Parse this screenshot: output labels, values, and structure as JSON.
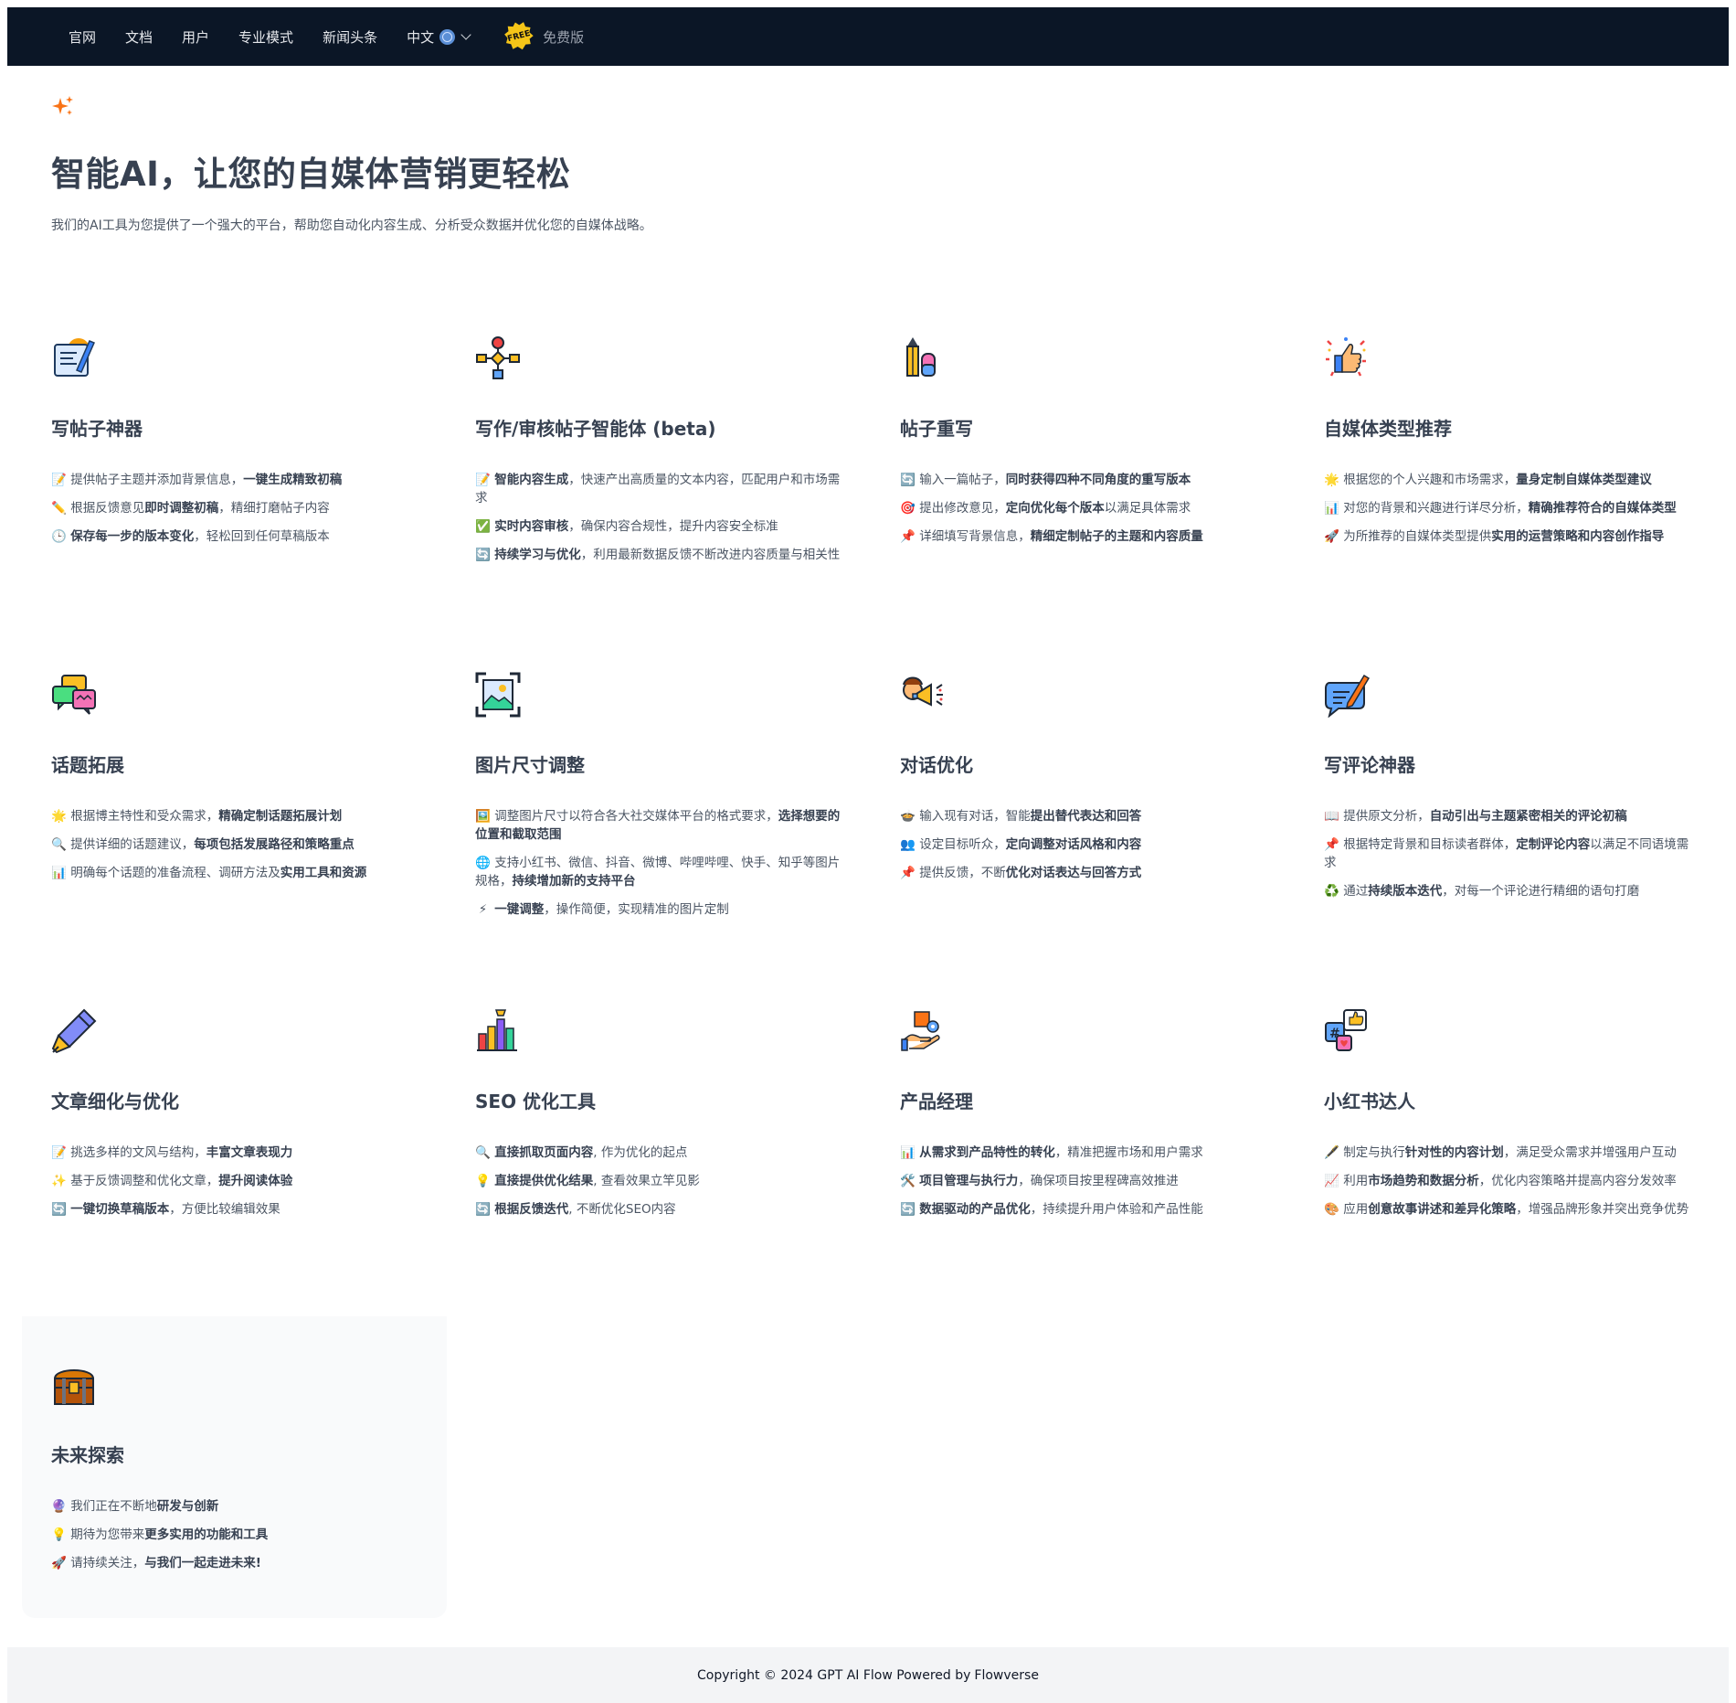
{
  "nav": {
    "items": [
      "官网",
      "文档",
      "用户",
      "专业模式",
      "新闻头条"
    ],
    "language": "中文",
    "badge_text": "FREE",
    "plan": "免费版"
  },
  "hero": {
    "icon": "sparkles-icon",
    "title": "智能AI，让您的自媒体营销更轻松",
    "subtitle": "我们的AI工具为您提供了一个强大的平台，帮助您自动化内容生成、分析受众数据并优化您的自媒体战略。"
  },
  "cards": [
    {
      "icon": "notepad-pen-icon",
      "title": "写帖子神器",
      "bullets": [
        {
          "emoji": "📝",
          "parts": [
            {
              "t": "提供帖子主题并添加背景信息，"
            },
            {
              "t": "一键生成精致初稿",
              "b": true
            }
          ]
        },
        {
          "emoji": "✏️",
          "parts": [
            {
              "t": "根据反馈意见"
            },
            {
              "t": "即时调整初稿",
              "b": true
            },
            {
              "t": "，精细打磨帖子内容"
            }
          ]
        },
        {
          "emoji": "🕒",
          "parts": [
            {
              "t": "保存每一步的版本变化",
              "b": true
            },
            {
              "t": "，轻松回到任何草稿版本"
            }
          ]
        }
      ]
    },
    {
      "icon": "flowchart-icon",
      "title": "写作/审核帖子智能体 (beta)",
      "bullets": [
        {
          "emoji": "📝",
          "parts": [
            {
              "t": "智能内容生成",
              "b": true
            },
            {
              "t": "，快速产出高质量的文本内容，匹配用户和市场需求"
            }
          ]
        },
        {
          "emoji": "✅",
          "parts": [
            {
              "t": "实时内容审核",
              "b": true
            },
            {
              "t": "，确保内容合规性，提升内容安全标准"
            }
          ]
        },
        {
          "emoji": "🔄",
          "parts": [
            {
              "t": "持续学习与优化",
              "b": true
            },
            {
              "t": "，利用最新数据反馈不断改进内容质量与相关性"
            }
          ]
        }
      ]
    },
    {
      "icon": "pencil-eraser-icon",
      "title": "帖子重写",
      "bullets": [
        {
          "emoji": "🔄",
          "parts": [
            {
              "t": "输入一篇帖子，"
            },
            {
              "t": "同时获得四种不同角度的重写版本",
              "b": true
            }
          ]
        },
        {
          "emoji": "🎯",
          "parts": [
            {
              "t": "提出修改意见，"
            },
            {
              "t": "定向优化每个版本",
              "b": true
            },
            {
              "t": "以满足具体需求"
            }
          ]
        },
        {
          "emoji": "📌",
          "parts": [
            {
              "t": "详细填写背景信息，"
            },
            {
              "t": "精细定制帖子的主题和内容质量",
              "b": true
            }
          ]
        }
      ]
    },
    {
      "icon": "thumbs-up-confetti-icon",
      "title": "自媒体类型推荐",
      "bullets": [
        {
          "emoji": "🌟",
          "parts": [
            {
              "t": "根据您的个人兴趣和市场需求，"
            },
            {
              "t": "量身定制自媒体类型建议",
              "b": true
            }
          ]
        },
        {
          "emoji": "📊",
          "parts": [
            {
              "t": "对您的背景和兴趣进行详尽分析，"
            },
            {
              "t": "精确推荐符合的自媒体类型",
              "b": true
            }
          ]
        },
        {
          "emoji": "🚀",
          "parts": [
            {
              "t": "为所推荐的自媒体类型提供"
            },
            {
              "t": "实用的运营策略和内容创作指导",
              "b": true
            }
          ]
        }
      ]
    },
    {
      "icon": "chat-bubbles-icon",
      "title": "话题拓展",
      "bullets": [
        {
          "emoji": "🌟",
          "parts": [
            {
              "t": "根据博主特性和受众需求，"
            },
            {
              "t": "精确定制话题拓展计划",
              "b": true
            }
          ]
        },
        {
          "emoji": "🔍",
          "parts": [
            {
              "t": "提供详细的话题建议，"
            },
            {
              "t": "每项包括发展路径和策略重点",
              "b": true
            }
          ]
        },
        {
          "emoji": "📊",
          "parts": [
            {
              "t": "明确每个话题的准备流程、调研方法及"
            },
            {
              "t": "实用工具和资源",
              "b": true
            }
          ]
        }
      ]
    },
    {
      "icon": "image-resize-icon",
      "title": "图片尺寸调整",
      "bullets": [
        {
          "emoji": "🖼️",
          "parts": [
            {
              "t": "调整图片尺寸以符合各大社交媒体平台的格式要求，"
            },
            {
              "t": "选择想要的位置和截取范围",
              "b": true
            }
          ]
        },
        {
          "emoji": "🌐",
          "parts": [
            {
              "t": "支持小红书、微信、抖音、微博、哔哩哔哩、快手、知乎等图片规格，"
            },
            {
              "t": "持续增加新的支持平台",
              "b": true
            }
          ]
        },
        {
          "emoji": "⚡",
          "parts": [
            {
              "t": "一键调整",
              "b": true
            },
            {
              "t": "，操作简便，实现精准的图片定制"
            }
          ]
        }
      ]
    },
    {
      "icon": "megaphone-person-icon",
      "title": "对话优化",
      "bullets": [
        {
          "emoji": "🍲",
          "parts": [
            {
              "t": "输入现有对话，智能"
            },
            {
              "t": "提出替代表达和回答",
              "b": true
            }
          ]
        },
        {
          "emoji": "👥",
          "parts": [
            {
              "t": "设定目标听众，"
            },
            {
              "t": "定向调整对话风格和内容",
              "b": true
            }
          ]
        },
        {
          "emoji": "📌",
          "parts": [
            {
              "t": "提供反馈，不断"
            },
            {
              "t": "优化对话表达与回答方式",
              "b": true
            }
          ]
        }
      ]
    },
    {
      "icon": "speech-pencil-icon",
      "title": "写评论神器",
      "bullets": [
        {
          "emoji": "📖",
          "parts": [
            {
              "t": "提供原文分析，"
            },
            {
              "t": "自动引出与主题紧密相关的评论初稿",
              "b": true
            }
          ]
        },
        {
          "emoji": "📌",
          "parts": [
            {
              "t": "根据特定背景和目标读者群体，"
            },
            {
              "t": "定制评论内容",
              "b": true
            },
            {
              "t": "以满足不同语境需求"
            }
          ]
        },
        {
          "emoji": "♻️",
          "parts": [
            {
              "t": "通过"
            },
            {
              "t": "持续版本迭代",
              "b": true
            },
            {
              "t": "，对每一个评论进行精细的语句打磨"
            }
          ]
        }
      ]
    },
    {
      "icon": "fountain-pen-icon",
      "title": "文章细化与优化",
      "bullets": [
        {
          "emoji": "📝",
          "parts": [
            {
              "t": "挑选多样的文风与结构，"
            },
            {
              "t": "丰富文章表现力",
              "b": true
            }
          ]
        },
        {
          "emoji": "✨",
          "parts": [
            {
              "t": "基于反馈调整和优化文章，"
            },
            {
              "t": "提升阅读体验",
              "b": true
            }
          ]
        },
        {
          "emoji": "🔄",
          "parts": [
            {
              "t": "一键切换草稿版本",
              "b": true
            },
            {
              "t": "，方便比较编辑效果"
            }
          ]
        }
      ]
    },
    {
      "icon": "bar-chart-trophy-icon",
      "title": "SEO 优化工具",
      "bullets": [
        {
          "emoji": "🔍",
          "parts": [
            {
              "t": "直接抓取页面内容",
              "b": true
            },
            {
              "t": ", 作为优化的起点"
            }
          ]
        },
        {
          "emoji": "💡",
          "parts": [
            {
              "t": "直接提供优化结果",
              "b": true
            },
            {
              "t": ", 查看效果立竿见影"
            }
          ]
        },
        {
          "emoji": "🔄",
          "parts": [
            {
              "t": "根据反馈迭代",
              "b": true
            },
            {
              "t": ", 不断优化SEO内容"
            }
          ]
        }
      ]
    },
    {
      "icon": "hand-box-gear-icon",
      "title": "产品经理",
      "bullets": [
        {
          "emoji": "📊",
          "parts": [
            {
              "t": "从需求到产品特性的转化",
              "b": true
            },
            {
              "t": "，精准把握市场和用户需求"
            }
          ]
        },
        {
          "emoji": "🛠️",
          "parts": [
            {
              "t": "项目管理与执行力",
              "b": true
            },
            {
              "t": "，确保项目按里程碑高效推进"
            }
          ]
        },
        {
          "emoji": "🔄",
          "parts": [
            {
              "t": "数据驱动的产品优化",
              "b": true
            },
            {
              "t": "，持续提升用户体验和产品性能"
            }
          ]
        }
      ]
    },
    {
      "icon": "social-media-icon",
      "title": "小红书达人",
      "bullets": [
        {
          "emoji": "🖋️",
          "parts": [
            {
              "t": "制定与执行"
            },
            {
              "t": "针对性的内容计划",
              "b": true
            },
            {
              "t": "，满足受众需求并增强用户互动"
            }
          ]
        },
        {
          "emoji": "📈",
          "parts": [
            {
              "t": "利用"
            },
            {
              "t": "市场趋势和数据分析",
              "b": true
            },
            {
              "t": "，优化内容策略并提高内容分发效率"
            }
          ]
        },
        {
          "emoji": "🎨",
          "parts": [
            {
              "t": "应用"
            },
            {
              "t": "创意故事讲述和差异化策略",
              "b": true
            },
            {
              "t": "，增强品牌形象并突出竞争优势"
            }
          ]
        }
      ]
    },
    {
      "icon": "treasure-chest-icon",
      "title": "未来探索",
      "bullets": [
        {
          "emoji": "🔮",
          "parts": [
            {
              "t": "我们正在不断地"
            },
            {
              "t": "研发与创新",
              "b": true
            }
          ]
        },
        {
          "emoji": "💡",
          "parts": [
            {
              "t": "期待为您带来"
            },
            {
              "t": "更多实用的功能和工具",
              "b": true
            }
          ]
        },
        {
          "emoji": "🚀",
          "parts": [
            {
              "t": "请持续关注，"
            },
            {
              "t": "与我们一起走进未来!",
              "b": true
            }
          ]
        }
      ]
    }
  ],
  "footer": {
    "text": "Copyright © 2024 GPT AI Flow Powered by",
    "link": "Flowverse"
  }
}
